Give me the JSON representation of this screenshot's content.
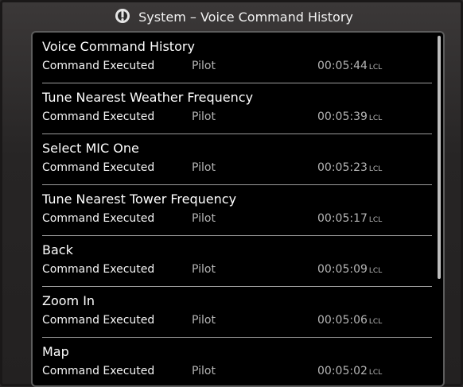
{
  "window": {
    "title": "System – Voice Command History"
  },
  "entries": [
    {
      "command": "Voice Command History",
      "status": "Command Executed",
      "user": "Pilot",
      "time": "00:05:44",
      "timezone": "LCL"
    },
    {
      "command": "Tune Nearest Weather Frequency",
      "status": "Command Executed",
      "user": "Pilot",
      "time": "00:05:39",
      "timezone": "LCL"
    },
    {
      "command": "Select MIC One",
      "status": "Command Executed",
      "user": "Pilot",
      "time": "00:05:23",
      "timezone": "LCL"
    },
    {
      "command": "Tune Nearest Tower Frequency",
      "status": "Command Executed",
      "user": "Pilot",
      "time": "00:05:17",
      "timezone": "LCL"
    },
    {
      "command": "Back",
      "status": "Command Executed",
      "user": "Pilot",
      "time": "00:05:09",
      "timezone": "LCL"
    },
    {
      "command": "Zoom In",
      "status": "Command Executed",
      "user": "Pilot",
      "time": "00:05:06",
      "timezone": "LCL"
    },
    {
      "command": "Map",
      "status": "Command Executed",
      "user": "Pilot",
      "time": "00:05:02",
      "timezone": "LCL"
    }
  ]
}
